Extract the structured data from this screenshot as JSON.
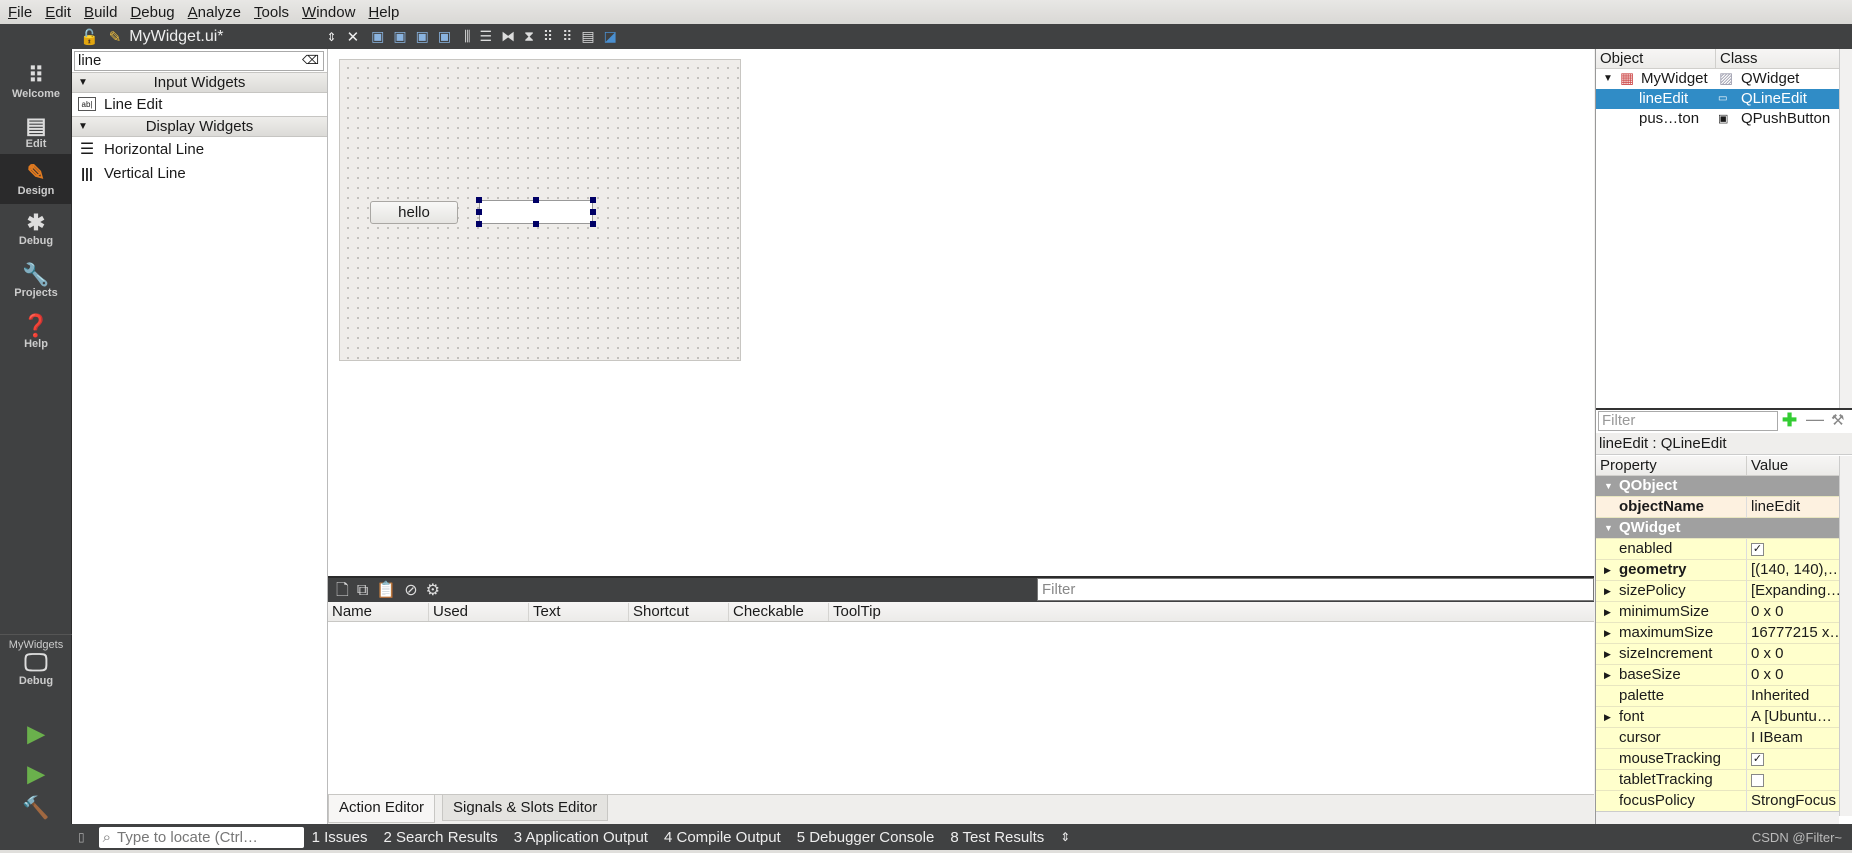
{
  "menu": [
    "File",
    "Edit",
    "Build",
    "Debug",
    "Analyze",
    "Tools",
    "Window",
    "Help"
  ],
  "editor": {
    "file_name": "MyWidget.ui*"
  },
  "modes": [
    {
      "label": "Welcome",
      "icon": "grid-icon"
    },
    {
      "label": "Edit",
      "icon": "document-icon"
    },
    {
      "label": "Design",
      "icon": "pencil-icon",
      "selected": true
    },
    {
      "label": "Debug",
      "icon": "bug-icon"
    },
    {
      "label": "Projects",
      "icon": "wrench-icon"
    },
    {
      "label": "Help",
      "icon": "help-icon"
    }
  ],
  "kit": {
    "project": "MyWidgets",
    "build": "Debug"
  },
  "widget_box": {
    "search": "line",
    "categories": [
      {
        "name": "Input Widgets",
        "items": [
          "Line Edit"
        ]
      },
      {
        "name": "Display Widgets",
        "items": [
          "Horizontal Line",
          "Vertical Line"
        ]
      }
    ]
  },
  "form": {
    "button_text": "hello",
    "line_edit_text": ""
  },
  "action_editor": {
    "filter_placeholder": "Filter",
    "columns": [
      "Name",
      "Used",
      "Text",
      "Shortcut",
      "Checkable",
      "ToolTip"
    ]
  },
  "bottom_tabs": [
    "Action Editor",
    "Signals & Slots Editor"
  ],
  "object_inspector": {
    "columns": [
      "Object",
      "Class"
    ],
    "rows": [
      {
        "object": "MyWidget",
        "class": "QWidget"
      },
      {
        "object": "lineEdit",
        "class": "QLineEdit",
        "selected": true
      },
      {
        "object": "pus…ton",
        "class": "QPushButton"
      }
    ]
  },
  "property_editor": {
    "filter_placeholder": "Filter",
    "context": "lineEdit : QLineEdit",
    "columns": [
      "Property",
      "Value"
    ],
    "rows": [
      {
        "name": "QObject",
        "category": true
      },
      {
        "name": "objectName",
        "value": "lineEdit",
        "bold": true
      },
      {
        "name": "QWidget",
        "category": true
      },
      {
        "name": "enabled",
        "checked": true
      },
      {
        "name": "geometry",
        "value": "[(140, 140),…",
        "bold": true,
        "expand": true
      },
      {
        "name": "sizePolicy",
        "value": "[Expanding…",
        "expand": true
      },
      {
        "name": "minimumSize",
        "value": "0 x 0",
        "expand": true
      },
      {
        "name": "maximumSize",
        "value": "16777215 x…",
        "expand": true
      },
      {
        "name": "sizeIncrement",
        "value": "0 x 0",
        "expand": true
      },
      {
        "name": "baseSize",
        "value": "0 x 0",
        "expand": true
      },
      {
        "name": "palette",
        "value": "Inherited"
      },
      {
        "name": "font",
        "value": "A  [Ubuntu…",
        "expand": true
      },
      {
        "name": "cursor",
        "value": "I  IBeam"
      },
      {
        "name": "mouseTracking",
        "checked": true
      },
      {
        "name": "tabletTracking",
        "checked": false
      },
      {
        "name": "focusPolicy",
        "value": "StrongFocus"
      }
    ]
  },
  "statusbar": {
    "locate_placeholder": "Type to locate (Ctrl…",
    "items": [
      "1  Issues",
      "2  Search Results",
      "3  Application Output",
      "4  Compile Output",
      "5  Debugger Console",
      "8  Test Results"
    ],
    "watermark": "CSDN @Filter~"
  },
  "colors": {
    "selection": "#308cc6",
    "dark_panel": "#404142",
    "property_bg": "#ffffcc",
    "run_green": "#6ab04c"
  }
}
